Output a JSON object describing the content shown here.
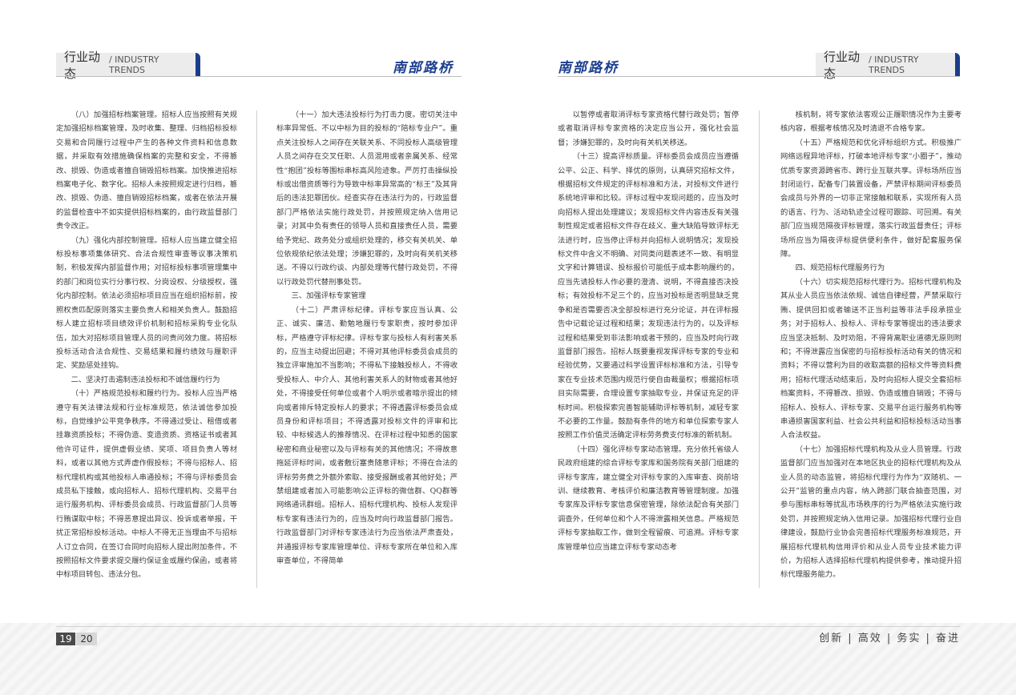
{
  "left_page": {
    "section_tab": {
      "cn": "行业动态",
      "en": "/ INDUSTRY TRENDS"
    },
    "brand": "南部路桥",
    "columns": [
      [
        "（八）加强招标档案管理。招标人应当按照有关规定加强招标档案管理，及时收集、整理、归档招标投标交易和合同履行过程中产生的各种文件资料和信息数据，并采取有效措施确保档案的完整和安全，不得篡改、损毁、伪造或者擅自销毁招标档案。加快推进招标档案电子化、数字化。招标人未按照规定进行归档，篡改、损毁、伪造、擅自销毁招标档案，或者在依法开展的监督检查中不如实提供招标档案的，由行政监督部门责令改正。",
        "（九）强化内部控制管理。招标人应当建立健全招标投标事项集体研究、合法合规性审查等议事决策机制，积极发挥内部监督作用；对招标投标事项管理集中的部门和岗位实行分事行权、分岗设权、分级授权，强化内部控制。依法必须招标项目应当在组织招标前，按照权责匹配原则落实主要负责人和相关负责人。鼓励招标人建立招标项目绩效评价机制和招标采购专业化队伍，加大对招标项目管理人员的问责问效力度。将招标投标活动合法合规性、交易结果和履约绩效与履职评定、奖励惩处挂钩。",
        "二、坚决打击遏制违法投标和不诚信履约行为",
        "（十）严格规范投标和履约行为。投标人应当严格遵守有关法律法规和行业标准规范，依法诚信参加投标，自觉维护公平竞争秩序。不得通过受让、租借或者挂靠资质投标；不得伪造、变造资质、资格证书或者其他许可证件，提供虚假业绩、奖项、项目负责人等材料，或者以其他方式弄虚作假投标；不得与招标人、招标代理机构或其他投标人串通投标；不得与评标委员会成员私下接触，或向招标人、招标代理机构、交易平台运行服务机构、评标委员会成员、行政监督部门人员等行贿谋取中标；不得恶意提出异议、投诉或者举报，干扰正常招标投标活动。中标人不得无正当理由不与招标人订立合同，在签订合同时向招标人提出附加条件，不按照招标文件要求提交履约保证金或履约保函，或者将中标项目转包、违法分包。"
      ],
      [
        "（十一）加大违法投标行为打击力度。密切关注中标率异常低、不以中标为目的投标的“陪标专业户”。重点关注投标人之间存在关联关系、不同投标人高级管理人员之间存在交叉任职、人员混用或者亲属关系、经常性“抱团”投标等围标串标高风险迹象。严厉打击操纵投标或出借资质等行为导致中标率异常高的“标王”及其背后的违法犯罪团伙。经查实存在违法行为的，行政监督部门严格依法实施行政处罚，并按照规定纳入信用记录；对其中负有责任的领导人员和直接责任人员，需要给予党纪、政务处分或组织处理的，移交有关机关、单位依规依纪依法处理；涉嫌犯罪的，及时向有关机关移送。不得以行政约谈、内部处理等代替行政处罚，不得以行政处罚代替刑事处罚。",
        "三、加强评标专家管理",
        "（十二）严肃评标纪律。评标专家应当认真、公正、诚实、廉洁、勤勉地履行专家职责，按时参加评标，严格遵守评标纪律。评标专家与投标人有利害关系的，应当主动提出回避；不得对其他评标委员会成员的独立评审施加不当影响；不得私下接触投标人，不得收受投标人、中介人、其他利害关系人的财物或者其他好处，不得接受任何单位或者个人明示或者暗示提出的倾向或者排斥特定投标人的要求；不得透露评标委员会成员身份和评标项目；不得透露对投标文件的评审和比较、中标候选人的推荐情况、在评标过程中知悉的国家秘密和商业秘密以及与评标有关的其他情况；不得故意拖延评标时间，或者敷衍塞责随意评标；不得在合法的评标劳务费之外额外索取、接受报酬或者其他好处；严禁组建或者加入可能影响公正评标的微信群、QQ群等网络通讯群组。招标人、招标代理机构、投标人发现评标专家有违法行为的，应当及时向行政监督部门报告。行政监督部门对评标专家违法行为应当依法严肃查处，并通报评标专家库管理单位、评标专家所在单位和入库审查单位，不得简单"
      ]
    ],
    "page_numbers": {
      "left": "19",
      "right": "20"
    }
  },
  "right_page": {
    "section_tab": {
      "cn": "行业动态",
      "en": "/ INDUSTRY TRENDS"
    },
    "brand": "南部路桥",
    "columns": [
      [
        "以暂停或者取消评标专家资格代替行政处罚；暂停或者取消评标专家资格的决定应当公开，强化社会监督；涉嫌犯罪的，及时向有关机关移送。",
        "（十三）提高评标质量。评标委员会成员应当遵循公平、公正、科学、择优的原则，认真研究招标文件，根据招标文件规定的评标标准和方法，对投标文件进行系统地评审和比较。评标过程中发现问题的，应当及时向招标人提出处理建议；发现招标文件内容违反有关强制性规定或者招标文件存在歧义、重大缺陷导致评标无法进行时，应当停止评标并向招标人说明情况；发现投标文件中含义不明确、对同类问题表述不一致、有明显文字和计算错误、投标报价可能低于成本影响履约的，应当先请投标人作必要的澄清、说明，不得直接否决投标；有效投标不足三个的，应当对投标是否明显缺乏竞争和是否需要否决全部投标进行充分论证，并在评标报告中记载论证过程和结果；发现违法行为的，以及评标过程和结果受到非法影响或者干预的，应当及时向行政监督部门报告。招标人既要重视发挥评标专家的专业和经验优势，又要通过科学设置评标标准和方法，引导专家在专业技术范围内规范行使自由裁量权；根据招标项目实际需要，合理设置专家抽取专业，并保证充足的评标时间。积极探索完善智能辅助评标等机制，减轻专家不必要的工作量。鼓励有条件的地方和单位探索专家人按照工作价值灵活确定评标劳务费支付标准的新机制。",
        "（十四）强化评标专家动态管理。充分依托省级人民政府组建的综合评标专家库和国务院有关部门组建的评标专家库，建立健全对评标专家的入库审查、岗前培训、继续教育、考核评价和廉洁教育等管理制度。加强专家库及评标专家信息保密管理，除依法配合有关部门调查外，任何单位和个人不得泄露相关信息。严格规范评标专家抽取工作，做到全程留痕、可追溯。评标专家库管理单位应当建立评标专家动态考"
      ],
      [
        "核机制，将专家依法客观公正履职情况作为主要考核内容，根据考核情况及时清退不合格专家。",
        "（十五）严格规范和优化评标组织方式。积极推广网络远程异地评标，打破本地评标专家“小圈子”，推动优质专家资源跨省市、跨行业互联共享。评标场所应当封闭运行，配备专门装置设备，严禁评标期间评标委员会成员与外界的一切非正常接触和联系，实现所有人员的语言、行为、活动轨迹全过程可跟踪、可回溯。有关部门应当规范隔夜评标管理，落实行政监督责任；评标场所应当为隔夜评标提供便利条件，做好配套服务保障。",
        "四、规范招标代理服务行为",
        "（十六）切实规范招标代理行为。招标代理机构及其从业人员应当依法依规、诚信自律经营，严禁采取行贿、提供回扣或者输送不正当利益等非法手段承揽业务；对于招标人、投标人、评标专家等提出的违法要求应当坚决抵制、及时劝阻，不得背离职业道德无原则附和；不得泄露应当保密的与招标投标活动有关的情况和资料；不得以营利为目的收取高额的招标文件等资料费用；招标代理活动结束后，及时向招标人提交全套招标档案资料，不得篡改、损毁、伪造或擅自销毁；不得与招标人、投标人、评标专家、交易平台运行服务机构等串通损害国家利益、社会公共利益和招标投标活动当事人合法权益。",
        "（十七）加强招标代理机构及从业人员管理。行政监督部门应当加强对在本地区执业的招标代理机构及从业人员的动态监管，将招标代理行为作为“双随机、一公开”监管的重点内容，纳入跨部门联合抽查范围，对参与围标串标等扰乱市场秩序的行为严格依法实施行政处罚，并按照规定纳入信用记录。加强招标代理行业自律建设，鼓励行业协会完善招标代理服务标准规范，开展招标代理机构信用评价和从业人员专业技术能力评价，为招标人选择招标代理机构提供参考，推动提升招标代理服务能力。"
      ]
    ],
    "slogan": "创新 | 高效 | 务实 | 奋进"
  }
}
